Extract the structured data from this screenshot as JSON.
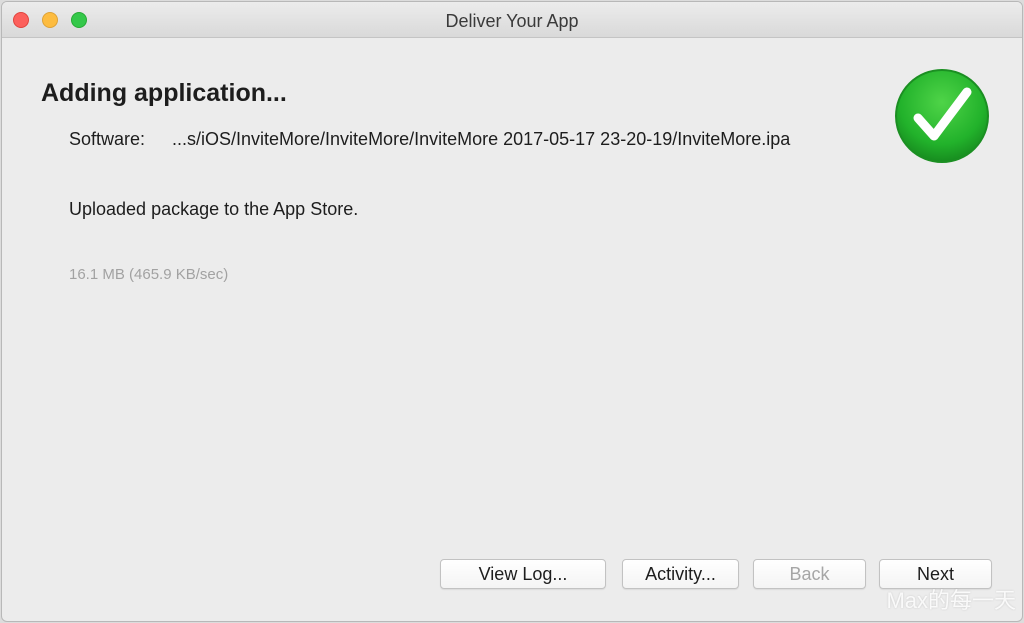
{
  "window": {
    "title": "Deliver Your App"
  },
  "content": {
    "heading": "Adding application...",
    "software_label": "Software:",
    "software_path": "...s/iOS/InviteMore/InviteMore/InviteMore 2017-05-17 23-20-19/InviteMore.ipa",
    "status": "Uploaded package to the App Store.",
    "transfer_info": "16.1 MB (465.9 KB/sec)",
    "success_icon": "checkmark-circle-icon"
  },
  "buttons": {
    "view_log": "View Log...",
    "activity": "Activity...",
    "back": "Back",
    "next": "Next"
  },
  "watermark": "Max的每一天",
  "colors": {
    "success_green": "#2ab831",
    "disabled_text": "#a6a6a6",
    "close": "#fc605c",
    "minimize": "#fdbc40",
    "zoom": "#34c84a"
  }
}
